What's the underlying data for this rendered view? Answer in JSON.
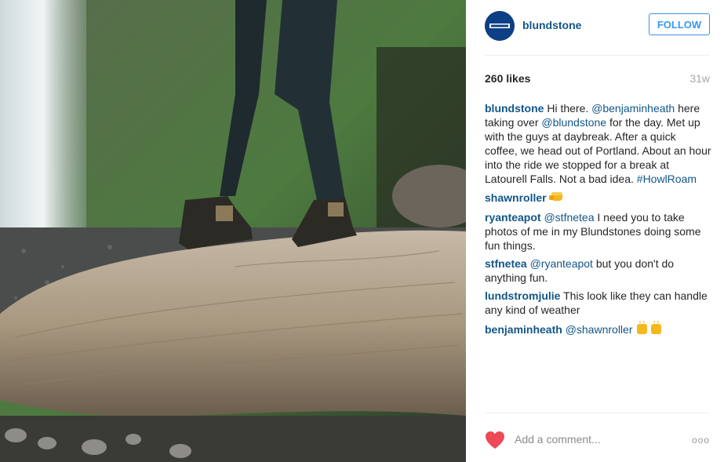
{
  "post": {
    "username": "blundstone",
    "follow_label": "FOLLOW",
    "likes": "260 likes",
    "age": "31w",
    "add_comment_placeholder": "Add a comment...",
    "more_icon": "ooo"
  },
  "comments": [
    {
      "user": "blundstone",
      "parts": [
        {
          "t": "Hi there. "
        },
        {
          "t": "@benjaminheath",
          "m": true
        },
        {
          "t": " here taking over "
        },
        {
          "t": "@blundstone",
          "m": true
        },
        {
          "t": " for the day. Met up with the guys at daybreak. After a quick coffee, we head out of Portland. About an hour into the ride we stopped for a break at Latourell Falls. Not a bad idea. "
        },
        {
          "t": "#HowlRoam",
          "m": true
        }
      ]
    },
    {
      "user": "shawnroller",
      "parts": [],
      "emoji": "fist-icon"
    },
    {
      "user": "ryanteapot",
      "parts": [
        {
          "t": "@stfnetea",
          "m": true
        },
        {
          "t": " I need you to take photos of me in my Blundstones doing some fun things."
        }
      ]
    },
    {
      "user": "stfnetea",
      "parts": [
        {
          "t": "@ryanteapot",
          "m": true
        },
        {
          "t": " but you don't do anything fun."
        }
      ]
    },
    {
      "user": "lundstromjulie",
      "parts": [
        {
          "t": "This look like they can handle any kind of weather"
        }
      ]
    },
    {
      "user": "benjaminheath",
      "parts": [
        {
          "t": "@shawnroller",
          "m": true
        }
      ],
      "emoji": "raised-hands-icon"
    }
  ],
  "colors": {
    "link": "#125688",
    "accent": "#3897f0",
    "heart": "#ed4956"
  }
}
